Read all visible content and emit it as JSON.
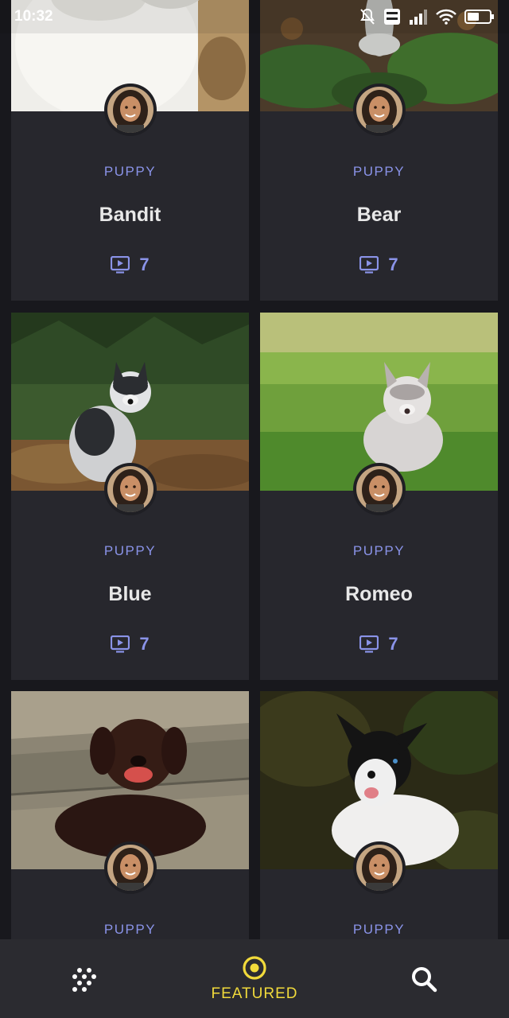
{
  "status_bar": {
    "time": "10:32",
    "icons": [
      "mute-icon",
      "volte-icon",
      "signal-icon",
      "wifi-icon",
      "battery-icon"
    ]
  },
  "cards": [
    {
      "category": "PUPPY",
      "name": "Bandit",
      "video_count": "7",
      "photo": "white-husky-closeup"
    },
    {
      "category": "PUPPY",
      "name": "Bear",
      "video_count": "7",
      "photo": "husky-on-leaves"
    },
    {
      "category": "PUPPY",
      "name": "Blue",
      "video_count": "7",
      "photo": "husky-puppy-under-pine"
    },
    {
      "category": "PUPPY",
      "name": "Romeo",
      "video_count": "7",
      "photo": "husky-puppy-on-grass"
    },
    {
      "category": "PUPPY",
      "name": "",
      "video_count": "",
      "photo": "chocolate-lab-puppy"
    },
    {
      "category": "PUPPY",
      "name": "",
      "video_count": "",
      "photo": "black-white-collie-puppy"
    }
  ],
  "bottom_nav": {
    "items": [
      {
        "icon": "dots-grid-icon",
        "label": ""
      },
      {
        "icon": "target-icon",
        "label": "FEATURED",
        "active": true
      },
      {
        "icon": "search-icon",
        "label": ""
      }
    ]
  },
  "colors": {
    "background": "#18181d",
    "card": "#27272d",
    "accent": "#8a93e8",
    "nav_active": "#f1da3b",
    "nav_bar": "#2b2b30"
  }
}
